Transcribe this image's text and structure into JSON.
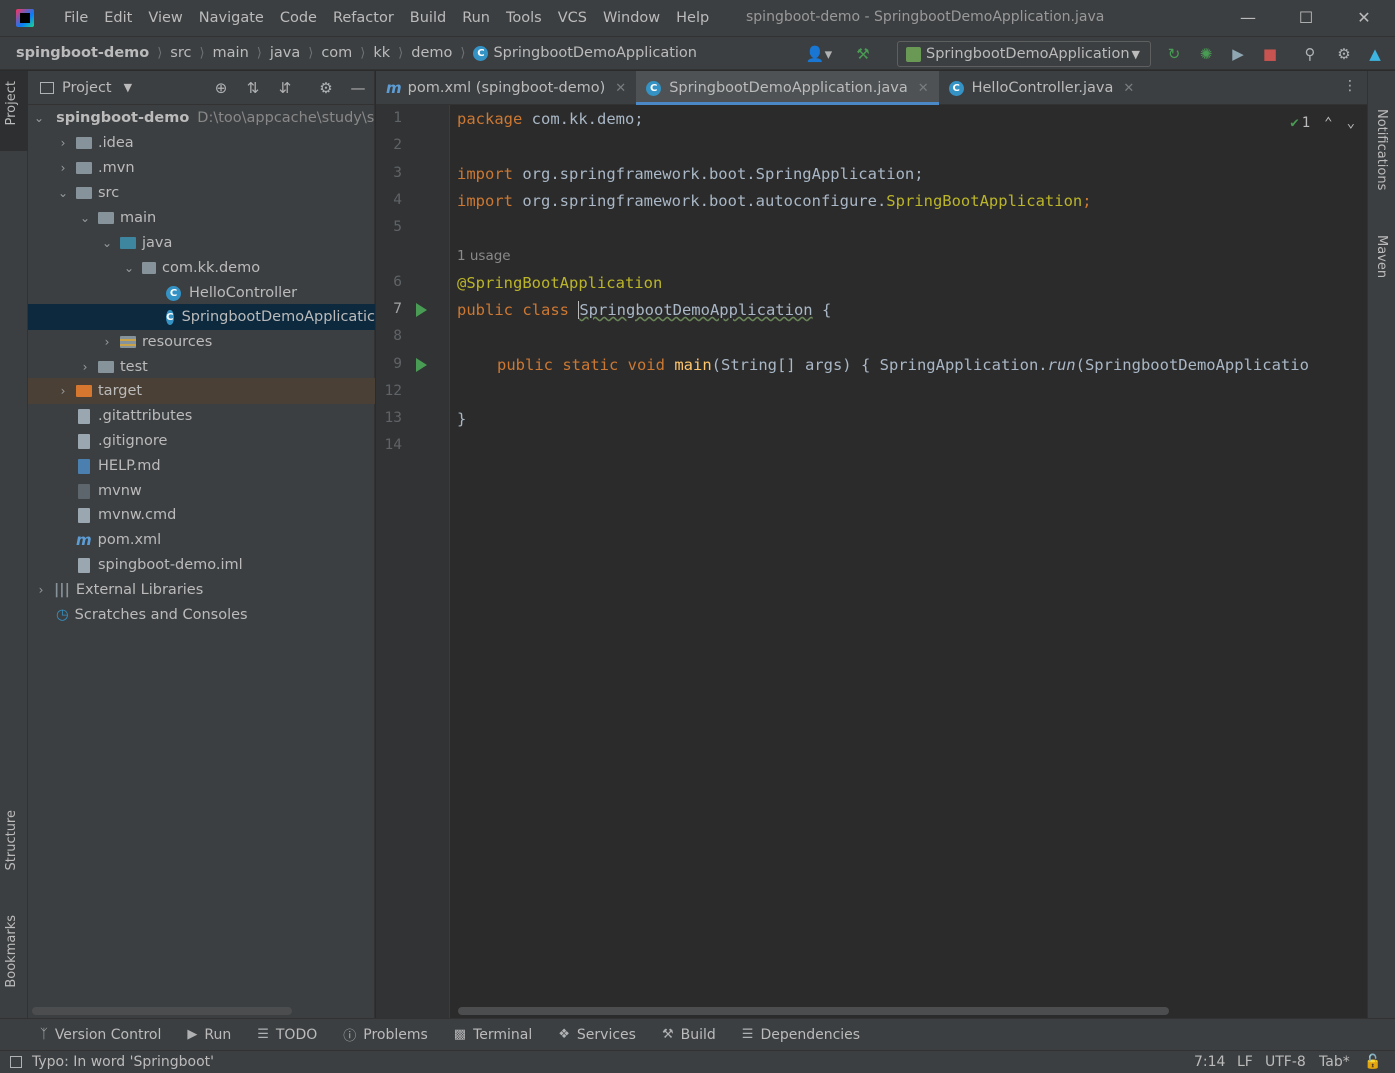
{
  "menu": [
    "File",
    "Edit",
    "View",
    "Navigate",
    "Code",
    "Refactor",
    "Build",
    "Run",
    "Tools",
    "VCS",
    "Window",
    "Help"
  ],
  "window_title": "spingboot-demo - SpringbootDemoApplication.java",
  "breadcrumbs": [
    "spingboot-demo",
    "src",
    "main",
    "java",
    "com",
    "kk",
    "demo",
    "SpringbootDemoApplication"
  ],
  "run_config": "SpringbootDemoApplication",
  "project_panel": {
    "title": "Project",
    "root_path": "D:\\too\\appcache\\study\\sp",
    "tree": [
      {
        "label": "spingboot-demo",
        "depth": 0,
        "arrow": "down",
        "icon": "module"
      },
      {
        "label": ".idea",
        "depth": 1,
        "arrow": "right",
        "icon": "folder"
      },
      {
        "label": ".mvn",
        "depth": 1,
        "arrow": "right",
        "icon": "folder"
      },
      {
        "label": "src",
        "depth": 1,
        "arrow": "down",
        "icon": "folder"
      },
      {
        "label": "main",
        "depth": 2,
        "arrow": "down",
        "icon": "folder"
      },
      {
        "label": "java",
        "depth": 3,
        "arrow": "down",
        "icon": "source-folder"
      },
      {
        "label": "com.kk.demo",
        "depth": 4,
        "arrow": "down",
        "icon": "package"
      },
      {
        "label": "HelloController",
        "depth": 5,
        "arrow": "",
        "icon": "class"
      },
      {
        "label": "SpringbootDemoApplicatic",
        "depth": 5,
        "arrow": "",
        "icon": "class"
      },
      {
        "label": "resources",
        "depth": 3,
        "arrow": "right",
        "icon": "resources-folder"
      },
      {
        "label": "test",
        "depth": 2,
        "arrow": "right",
        "icon": "folder"
      },
      {
        "label": "target",
        "depth": 1,
        "arrow": "right",
        "icon": "excluded-folder"
      },
      {
        "label": ".gitattributes",
        "depth": 1,
        "arrow": "",
        "icon": "file"
      },
      {
        "label": ".gitignore",
        "depth": 1,
        "arrow": "",
        "icon": "file"
      },
      {
        "label": "HELP.md",
        "depth": 1,
        "arrow": "",
        "icon": "markdown-file"
      },
      {
        "label": "mvnw",
        "depth": 1,
        "arrow": "",
        "icon": "file"
      },
      {
        "label": "mvnw.cmd",
        "depth": 1,
        "arrow": "",
        "icon": "file"
      },
      {
        "label": "pom.xml",
        "depth": 1,
        "arrow": "",
        "icon": "maven-file"
      },
      {
        "label": "spingboot-demo.iml",
        "depth": 1,
        "arrow": "",
        "icon": "file"
      },
      {
        "label": "External Libraries",
        "depth": 0,
        "arrow": "right",
        "icon": "libraries"
      },
      {
        "label": "Scratches and Consoles",
        "depth": 0,
        "arrow": "",
        "icon": "scratches"
      }
    ]
  },
  "tabs": [
    {
      "label": "pom.xml (spingboot-demo)",
      "icon": "m"
    },
    {
      "label": "SpringbootDemoApplication.java",
      "icon": "c"
    },
    {
      "label": "HelloController.java",
      "icon": "c"
    }
  ],
  "editor": {
    "line_numbers": [
      "1",
      "2",
      "3",
      "4",
      "5",
      "6",
      "7",
      "8",
      "9",
      "12",
      "13",
      "14"
    ],
    "usage_hint": "1 usage",
    "inspection_count": "1",
    "code": {
      "l1_kw": "package",
      "l1_rest": " com.kk.demo;",
      "l3_kw": "import",
      "l3_rest": " org.springframework.boot.SpringApplication;",
      "l4_kw": "import",
      "l4_rest": " org.springframework.boot.autoconfigure.",
      "l4_ann": "SpringBootApplication",
      "l4_end": ";",
      "l6": "@SpringBootApplication",
      "l7_kw": "public class",
      "l7_name": "SpringbootDemoApplication",
      "l7_end": " {",
      "l9_kw": "public static void",
      "l9_meth": "main",
      "l9_args": "(String[] args) { ",
      "l9_call": "SpringApplication.",
      "l9_run": "run",
      "l9_rest": "(SpringbootDemoApplicatio",
      "l13": "}"
    }
  },
  "left_stripe": [
    "Project",
    "Structure",
    "Bookmarks"
  ],
  "right_stripe": [
    "Notifications",
    "Maven"
  ],
  "bottom_tools": [
    "Version Control",
    "Run",
    "TODO",
    "Problems",
    "Terminal",
    "Services",
    "Build",
    "Dependencies"
  ],
  "status": {
    "message": "Typo: In word 'Springboot'",
    "position": "7:14",
    "line_sep": "LF",
    "encoding": "UTF-8",
    "indent": "Tab*"
  }
}
